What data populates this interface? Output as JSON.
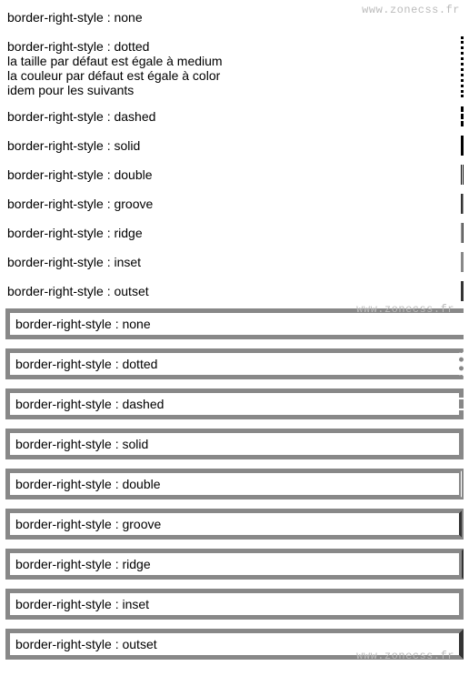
{
  "watermark": "www.zonecss.fr",
  "top": {
    "items": [
      {
        "label": "border-right-style : none",
        "style": "none"
      },
      {
        "label": "border-right-style : dotted",
        "style": "dotted",
        "extra1": "la taille par défaut est égale à medium",
        "extra2": "la couleur par défaut est égale à color",
        "extra3": "idem pour les suivants"
      },
      {
        "label": "border-right-style : dashed",
        "style": "dashed"
      },
      {
        "label": "border-right-style : solid",
        "style": "solid"
      },
      {
        "label": "border-right-style : double",
        "style": "double"
      },
      {
        "label": "border-right-style : groove",
        "style": "groove"
      },
      {
        "label": "border-right-style : ridge",
        "style": "ridge"
      },
      {
        "label": "border-right-style : inset",
        "style": "inset"
      },
      {
        "label": "border-right-style : outset",
        "style": "outset"
      }
    ]
  },
  "bottom": {
    "items": [
      {
        "label": "border-right-style : none",
        "style": "none"
      },
      {
        "label": "border-right-style : dotted",
        "style": "dotted"
      },
      {
        "label": "border-right-style : dashed",
        "style": "dashed"
      },
      {
        "label": "border-right-style : solid",
        "style": "solid"
      },
      {
        "label": "border-right-style : double",
        "style": "double"
      },
      {
        "label": "border-right-style : groove",
        "style": "groove"
      },
      {
        "label": "border-right-style : ridge",
        "style": "ridge"
      },
      {
        "label": "border-right-style : inset",
        "style": "inset"
      },
      {
        "label": "border-right-style : outset",
        "style": "outset"
      }
    ]
  }
}
